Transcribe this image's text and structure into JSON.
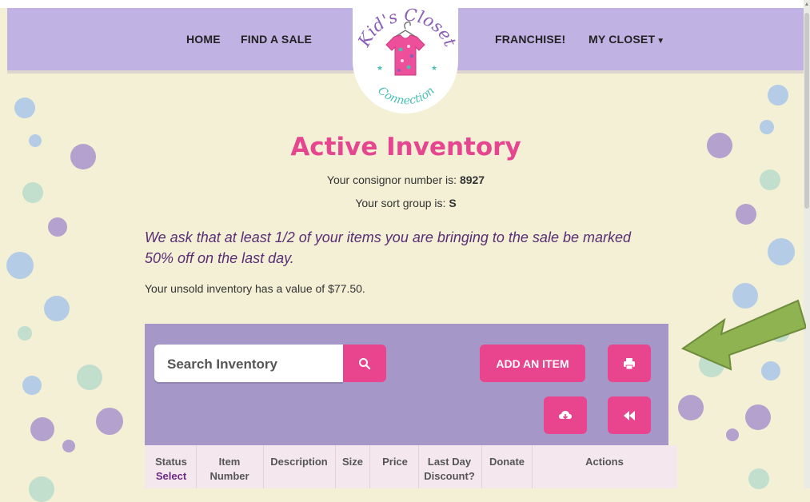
{
  "nav": {
    "home": "HOME",
    "find_a_sale": "FIND A SALE",
    "franchise": "FRANCHISE!",
    "my_closet": "MY CLOSET"
  },
  "logo": {
    "brand_text": "Kid's Closet Connection",
    "top_text": "Kid's Closet",
    "bottom_text": "Connection",
    "colors": {
      "purple": "#8b5fb8",
      "teal": "#48c0b4",
      "pink": "#ee4f9a"
    }
  },
  "page": {
    "title": "Active Inventory",
    "consignor_prefix": "Your consignor number is: ",
    "consignor_number": "8927",
    "sort_prefix": "Your sort group is: ",
    "sort_group": "S",
    "notice_line1": "We ask that at least 1/2 of your items you are bringing to the sale be marked",
    "notice_line2": "50% off on the last day.",
    "inventory_value_text": "Your unsold inventory has a value of $77.50."
  },
  "toolbar": {
    "search_placeholder": "Search Inventory",
    "add_item_label": "ADD AN ITEM",
    "icons": [
      "search-icon",
      "print-icon",
      "cloud-download-icon",
      "rewind-icon"
    ]
  },
  "table": {
    "columns": [
      {
        "label": "Status",
        "sub": "Select"
      },
      {
        "label": "Item",
        "sub": "Number"
      },
      {
        "label": "Description",
        "sub": ""
      },
      {
        "label": "Size",
        "sub": ""
      },
      {
        "label": "Price",
        "sub": ""
      },
      {
        "label": "Last Day",
        "sub": "Discount?"
      },
      {
        "label": "Donate",
        "sub": ""
      },
      {
        "label": "Actions",
        "sub": ""
      }
    ]
  },
  "theme": {
    "background": "#f3f0d6",
    "header": "#c1b2e4",
    "panel": "#a598c8",
    "accent_pink": "#e8458e",
    "notice_purple": "#5a2d74",
    "arrow_green": "#8fb350"
  }
}
